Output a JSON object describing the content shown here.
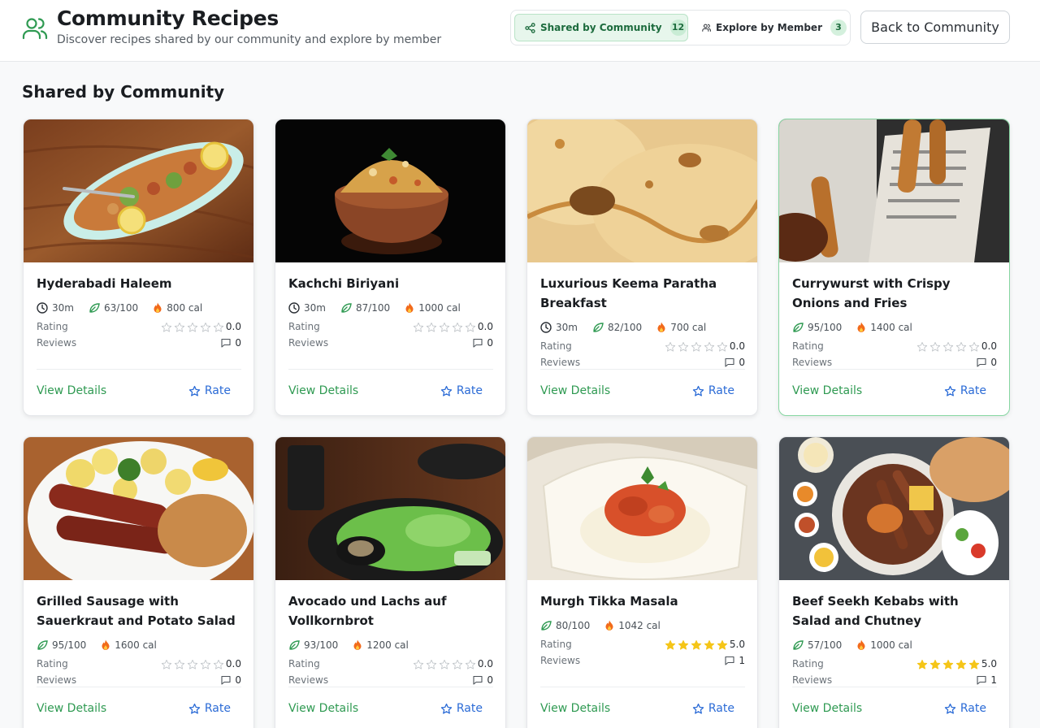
{
  "header": {
    "title": "Community Recipes",
    "subtitle": "Discover recipes shared by our community and explore by member",
    "icon": "users-icon",
    "accent": "#2f9a52"
  },
  "tabs": [
    {
      "label": "Shared by Community",
      "count": "12",
      "icon": "share-icon",
      "active": true
    },
    {
      "label": "Explore by Member",
      "count": "3",
      "icon": "users-icon",
      "active": false
    }
  ],
  "back_button": "Back to Community",
  "section_title": "Shared by Community",
  "labels": {
    "rating": "Rating",
    "reviews": "Reviews",
    "view_details": "View Details",
    "rate": "Rate"
  },
  "recipes": [
    {
      "title": "Hyderabadi Haleem",
      "time": "30m",
      "score": "63/100",
      "calories": "800 cal",
      "rating_text": "0.0",
      "rating": 0,
      "reviews": "0",
      "image": "haleem-bowl-photo"
    },
    {
      "title": "Kachchi Biriyani",
      "time": "30m",
      "score": "87/100",
      "calories": "1000 cal",
      "rating_text": "0.0",
      "rating": 0,
      "reviews": "0",
      "image": "biriyani-pot-photo"
    },
    {
      "title": "Luxurious Keema Paratha Breakfast",
      "time": "30m",
      "score": "82/100",
      "calories": "700 cal",
      "rating_text": "0.0",
      "rating": 0,
      "reviews": "0",
      "image": "paratha-photo"
    },
    {
      "title": "Currywurst with Crispy Onions and Fries",
      "time": "",
      "score": "95/100",
      "calories": "1400 cal",
      "rating_text": "0.0",
      "rating": 0,
      "reviews": "0",
      "image": "churros-newspaper-photo"
    },
    {
      "title": "Grilled Sausage with Sauerkraut and Potato Salad",
      "time": "",
      "score": "95/100",
      "calories": "1600 cal",
      "rating_text": "0.0",
      "rating": 0,
      "reviews": "0",
      "image": "sausage-plate-photo"
    },
    {
      "title": "Avocado und Lachs auf Vollkornbrot",
      "time": "",
      "score": "93/100",
      "calories": "1200 cal",
      "rating_text": "0.0",
      "rating": 0,
      "reviews": "0",
      "image": "salad-plate-photo"
    },
    {
      "title": "Murgh Tikka Masala",
      "time": "",
      "score": "80/100",
      "calories": "1042 cal",
      "rating_text": "5.0",
      "rating": 5,
      "reviews": "1",
      "image": "tikka-masala-photo"
    },
    {
      "title": "Beef Seekh Kebabs with Salad and Chutney",
      "time": "",
      "score": "57/100",
      "calories": "1000 cal",
      "rating_text": "5.0",
      "rating": 5,
      "reviews": "1",
      "image": "kebab-platter-photo"
    }
  ]
}
